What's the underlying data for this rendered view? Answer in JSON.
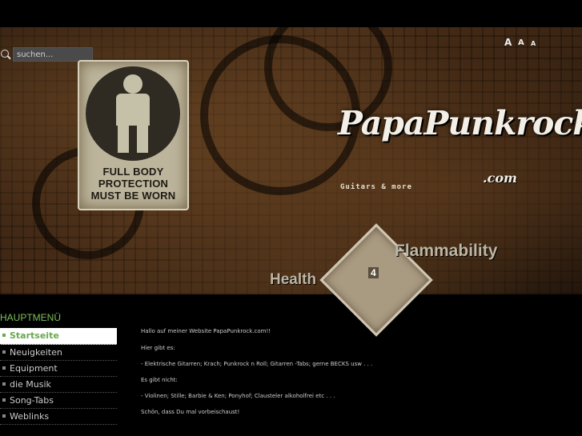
{
  "search": {
    "placeholder": "suchen..."
  },
  "font_sizes": [
    "A",
    "A",
    "A"
  ],
  "header": {
    "sign_lines": [
      "FULL BODY",
      "PROTECTION",
      "MUST BE WORN"
    ],
    "logo": "PapaPunkrock",
    "logo_suffix": ".com",
    "tagline": "Guitars & more",
    "flammability": "Flammability",
    "health": "Health",
    "diamond_number": "4"
  },
  "menu": {
    "title": "HAUPTMENÜ",
    "items": [
      {
        "label": "Startseite",
        "active": true
      },
      {
        "label": "Neuigkeiten",
        "active": false
      },
      {
        "label": "Equipment",
        "active": false
      },
      {
        "label": "die Musik",
        "active": false
      },
      {
        "label": "Song-Tabs",
        "active": false
      },
      {
        "label": "Weblinks",
        "active": false
      }
    ]
  },
  "content": {
    "lines": [
      "Hallo auf meiner Website PapaPunkrock.com!!",
      "Hier gibt es:",
      "- Elektrische Gitarren; Krach; Punkrock n Roll; Gitarren -Tabs; gerne BECKS usw . . .",
      "Es gibt nicht:",
      "- Violinen; Stille; Barbie & Ken; Ponyhof; Clausteler alkoholfrei etc . . .",
      "Schön, dass Du mal vorbeischaust!"
    ]
  }
}
